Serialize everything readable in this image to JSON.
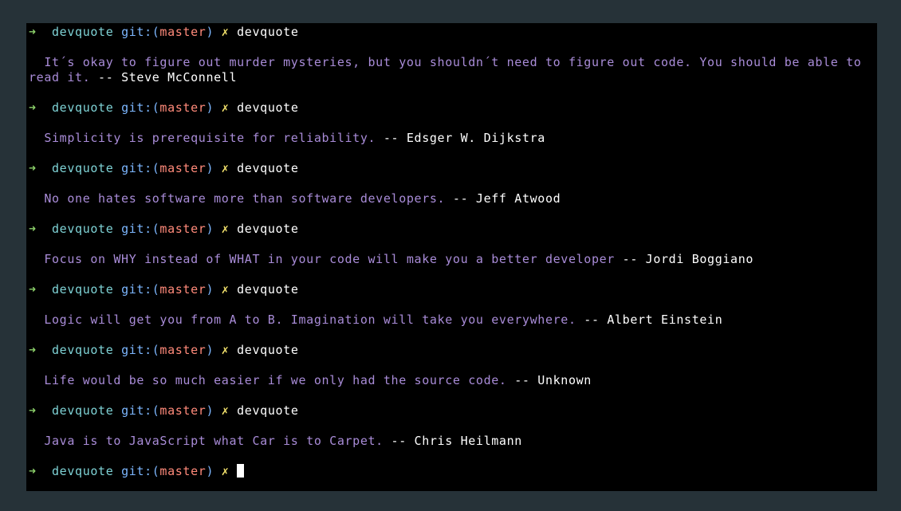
{
  "terminal": {
    "prompt": {
      "arrow": "➜",
      "dir": "devquote",
      "git_label": "git:",
      "branch_open": "(",
      "branch": "master",
      "branch_close": ")",
      "dirty_mark": "✗"
    },
    "entries": [
      {
        "command": "devquote",
        "quote": "It´s okay to figure out murder mysteries, but you shouldn´t need to figure out code. You should be able to read it.",
        "separator": " -- ",
        "author": "Steve McConnell"
      },
      {
        "command": "devquote",
        "quote": "Simplicity is prerequisite for reliability.",
        "separator": " -- ",
        "author": "Edsger W. Dijkstra"
      },
      {
        "command": "devquote",
        "quote": "No one hates software more than software developers.",
        "separator": " -- ",
        "author": "Jeff Atwood"
      },
      {
        "command": "devquote",
        "quote": "Focus on WHY instead of WHAT in your code will make you a better developer",
        "separator": " -- ",
        "author": "Jordi Boggiano"
      },
      {
        "command": "devquote",
        "quote": "Logic will get you from A to B. Imagination will take you everywhere.",
        "separator": " -- ",
        "author": "Albert Einstein"
      },
      {
        "command": "devquote",
        "quote": "Life would be so much easier if we only had the source code.",
        "separator": " -- ",
        "author": "Unknown"
      },
      {
        "command": "devquote",
        "quote": "Java is to JavaScript what Car is to Carpet.",
        "separator": " -- ",
        "author": "Chris Heilmann"
      }
    ],
    "final_command": ""
  }
}
